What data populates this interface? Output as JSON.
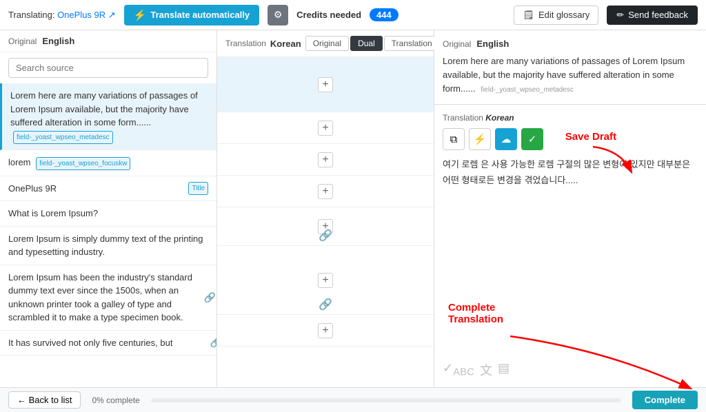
{
  "topbar": {
    "translating_label": "Translating:",
    "translating_project": "OnePlus 9R",
    "translate_auto_label": "Translate automatically",
    "credits_label": "Credits needed",
    "credits_value": "444",
    "edit_glossary_label": "Edit glossary",
    "send_feedback_label": "Send feedback"
  },
  "left_panel": {
    "original_label": "Original",
    "lang": "English",
    "search_placeholder": "Search source",
    "items": [
      {
        "text": "Lorem here are many variations of passages of Lorem Ipsum available, but the majority have suffered alteration in some form......",
        "tag": "field-_yoast_wpseo_metadesc",
        "active": true
      },
      {
        "text": "lorem",
        "tag": "field-_yoast_wpseo_focuskw",
        "active": false
      },
      {
        "text": "OnePlus 9R",
        "tag": "Title",
        "active": false
      },
      {
        "text": "What is Lorem Ipsum?",
        "tag": "",
        "active": false
      },
      {
        "text": "Lorem Ipsum is simply dummy text of the printing and typesetting industry.",
        "tag": "",
        "active": false
      },
      {
        "text": "Lorem Ipsum has been the industry's standard dummy text ever since the 1500s, when an unknown printer took a galley of type and scrambled it to make a type specimen book.",
        "tag": "",
        "active": false
      },
      {
        "text": "It has survived not only five centuries, but",
        "tag": "",
        "active": false
      }
    ]
  },
  "middle_panel": {
    "translation_label": "Translation",
    "lang": "Korean",
    "views": [
      "Original",
      "Dual",
      "Translation"
    ],
    "active_view": "Dual"
  },
  "right_panel": {
    "original_label": "Original",
    "lang": "English",
    "original_text": "Lorem here are many variations of passages of Lorem Ipsum available, but the majority have suffered alteration in some form......",
    "field_tag": "field-_yoast_wpseo_metadesc",
    "translation_label": "Translation",
    "translation_lang": "Korean",
    "translated_text": "여기 로렘 은 사용 가능한 로렘 구절의 많은 변형이 있지만 대부분은 어떤 형태로든 변경을 겪었습니다.....",
    "save_draft_annotation": "Save Draft",
    "complete_annotation": "Complete\nTranslation"
  },
  "bottom_bar": {
    "back_label": "← Back to list",
    "progress_label": "0% complete",
    "progress_pct": 0,
    "complete_label": "Complete"
  }
}
